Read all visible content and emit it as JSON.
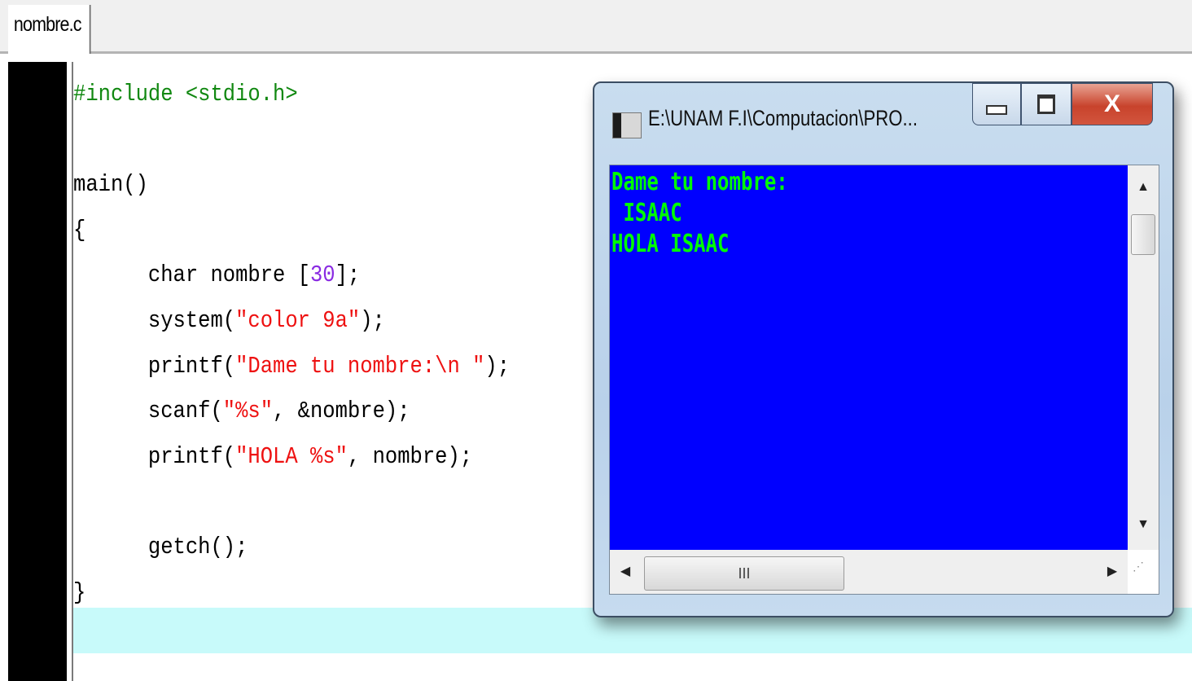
{
  "tab": {
    "label": "nombre.c"
  },
  "editor": {
    "lines": [
      [
        {
          "t": "#include <stdio.h>",
          "c": "pre"
        }
      ],
      [],
      [
        {
          "t": "main()",
          "c": ""
        }
      ],
      [
        {
          "t": "{",
          "c": ""
        }
      ],
      [
        {
          "t": "      char nombre [",
          "c": ""
        },
        {
          "t": "30",
          "c": "num"
        },
        {
          "t": "];",
          "c": ""
        }
      ],
      [
        {
          "t": "      system(",
          "c": ""
        },
        {
          "t": "\"color 9a\"",
          "c": "str"
        },
        {
          "t": ");",
          "c": ""
        }
      ],
      [
        {
          "t": "      printf(",
          "c": ""
        },
        {
          "t": "\"Dame tu nombre:\\n \"",
          "c": "str"
        },
        {
          "t": ");",
          "c": ""
        }
      ],
      [
        {
          "t": "      scanf(",
          "c": ""
        },
        {
          "t": "\"%s\"",
          "c": "str"
        },
        {
          "t": ", &nombre);",
          "c": ""
        }
      ],
      [
        {
          "t": "      printf(",
          "c": ""
        },
        {
          "t": "\"HOLA %s\"",
          "c": "str"
        },
        {
          "t": ", nombre);",
          "c": ""
        }
      ],
      [],
      [
        {
          "t": "      getch();",
          "c": ""
        }
      ],
      [
        {
          "t": "}",
          "c": ""
        }
      ]
    ]
  },
  "console": {
    "title": "E:\\UNAM F.I\\Computacion\\PRO...",
    "close_label": "X",
    "output": "Dame tu nombre:\n ISAAC\nHOLA ISAAC",
    "scroll": {
      "up": "▲",
      "down": "▼",
      "left": "◀",
      "right": "▶",
      "thumb_grip": "III",
      "resize_grip": "⋰"
    }
  },
  "colors": {
    "console_bg": "#0000ff",
    "console_text": "#00ff00",
    "current_line": "#c8fafa"
  }
}
